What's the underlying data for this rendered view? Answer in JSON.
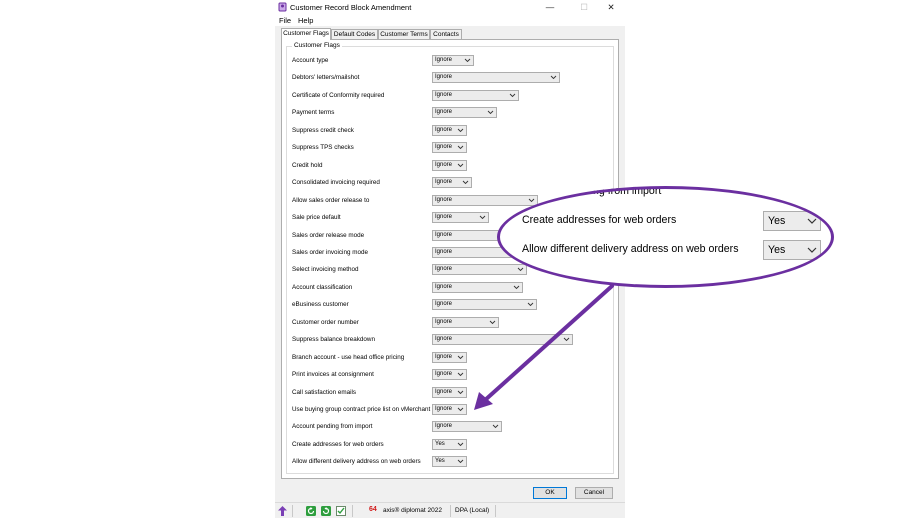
{
  "window": {
    "title": "Customer Record Block Amendment",
    "minimize": "—",
    "maximize": "☐",
    "close": "✕"
  },
  "menu": [
    "File",
    "Help"
  ],
  "tabs": [
    "Customer Flags",
    "Default Codes",
    "Customer Terms",
    "Contacts"
  ],
  "group_title": "Customer Flags",
  "flags": [
    {
      "label": "Account type",
      "value": "Ignore"
    },
    {
      "label": "Debtors' letters/mailshot",
      "value": "Ignore"
    },
    {
      "label": "Certificate of Conformity required",
      "value": "Ignore"
    },
    {
      "label": "Payment terms",
      "value": "Ignore"
    },
    {
      "label": "Suppress credit check",
      "value": "Ignore"
    },
    {
      "label": "Suppress TPS checks",
      "value": "Ignore"
    },
    {
      "label": "Credit hold",
      "value": "Ignore"
    },
    {
      "label": "Consolidated invoicing required",
      "value": "Ignore"
    },
    {
      "label": "Allow sales order release to",
      "value": "Ignore"
    },
    {
      "label": "Sale price default",
      "value": "Ignore"
    },
    {
      "label": "Sales order release mode",
      "value": "Ignore"
    },
    {
      "label": "Sales order invoicing mode",
      "value": "Ignore"
    },
    {
      "label": "Select invoicing method",
      "value": "Ignore"
    },
    {
      "label": "Account classification",
      "value": "Ignore"
    },
    {
      "label": "eBusiness customer",
      "value": "Ignore"
    },
    {
      "label": "Customer order number",
      "value": "Ignore"
    },
    {
      "label": "Suppress balance breakdown",
      "value": "Ignore"
    },
    {
      "label": "Branch account - use head office pricing",
      "value": "Ignore"
    },
    {
      "label": "Print invoices at consignment",
      "value": "Ignore"
    },
    {
      "label": "Call satisfaction emails",
      "value": "Ignore"
    },
    {
      "label": "Use buying group contract price list on vMerchant",
      "value": "Ignore"
    },
    {
      "label": "Account pending from import",
      "value": "Ignore"
    },
    {
      "label": "Create addresses for web orders",
      "value": "Yes"
    },
    {
      "label": "Allow different delivery address on web orders",
      "value": "Yes"
    }
  ],
  "buttons": {
    "ok": "OK",
    "cancel": "Cancel"
  },
  "status": {
    "product": "axis® diplomat 2022",
    "db": "DPA (Local)",
    "badge": "64"
  },
  "callout": {
    "partial_label": "ng from import",
    "rows": [
      {
        "label": "Create addresses for web orders",
        "value": "Yes"
      },
      {
        "label": "Allow different delivery address on web orders",
        "value": "Yes"
      }
    ]
  },
  "colors": {
    "callout_ring": "#6b2fa0",
    "accent": "#0078d7"
  },
  "icons": [
    "app-icon",
    "up-arrow-icon",
    "refresh-icon",
    "refresh-alt-icon",
    "checklist-icon",
    "chevron-down-icon"
  ]
}
